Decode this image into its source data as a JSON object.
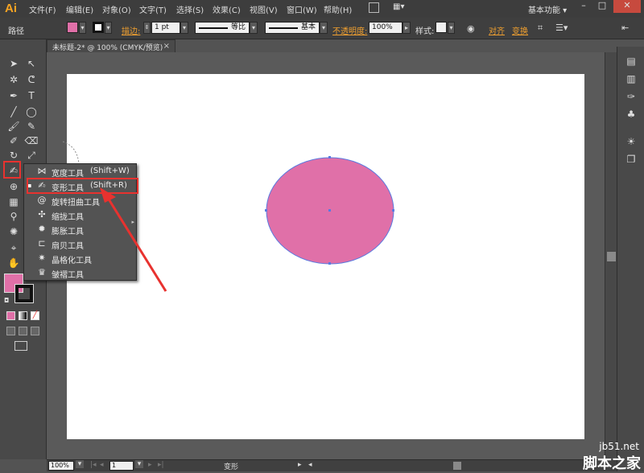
{
  "app": {
    "logo": "Ai",
    "workspace": "基本功能"
  },
  "menu": [
    "文件(F)",
    "编辑(E)",
    "对象(O)",
    "文字(T)",
    "选择(S)",
    "效果(C)",
    "视图(V)",
    "窗口(W)",
    "帮助(H)"
  ],
  "window_controls": {
    "minimize": "–",
    "restore": "□",
    "close": "✕"
  },
  "control_bar": {
    "path_label": "路径",
    "fill_color": "#e070a8",
    "stroke_link": "描边:",
    "stroke_weight": "1 pt",
    "profile_label": "等比",
    "brush_label": "基本",
    "opacity_link": "不透明度:",
    "opacity_value": "100%",
    "style_label": "样式:",
    "align_link": "对齐",
    "transform_link": "变换"
  },
  "document_tab": {
    "title": "未标题-2* @ 100% (CMYK/预览)",
    "close": "×"
  },
  "canvas": {
    "ellipse_fill": "#e070a8",
    "ellipse_stroke": "#5a7ae0"
  },
  "tool_flyout": {
    "items": [
      {
        "label": "宽度工具",
        "shortcut": "(Shift+W)",
        "icon": "width-tool-icon"
      },
      {
        "label": "变形工具",
        "shortcut": "(Shift+R)",
        "icon": "warp-tool-icon",
        "selected": true
      },
      {
        "label": "旋转扭曲工具",
        "shortcut": "",
        "icon": "twirl-tool-icon"
      },
      {
        "label": "缩拢工具",
        "shortcut": "",
        "icon": "pucker-tool-icon"
      },
      {
        "label": "膨胀工具",
        "shortcut": "",
        "icon": "bloat-tool-icon"
      },
      {
        "label": "扇贝工具",
        "shortcut": "",
        "icon": "scallop-tool-icon"
      },
      {
        "label": "晶格化工具",
        "shortcut": "",
        "icon": "crystallize-tool-icon"
      },
      {
        "label": "皱褶工具",
        "shortcut": "",
        "icon": "wrinkle-tool-icon"
      }
    ]
  },
  "status_bar": {
    "zoom": "100%",
    "page": "1",
    "tool_name": "变形"
  },
  "watermark": {
    "url": "jb51.net",
    "site": "脚本之家"
  },
  "colors": {
    "annotation_red": "#e8322f",
    "fill_swatch": "#e070a8",
    "stroke_swatch": "#000000"
  }
}
